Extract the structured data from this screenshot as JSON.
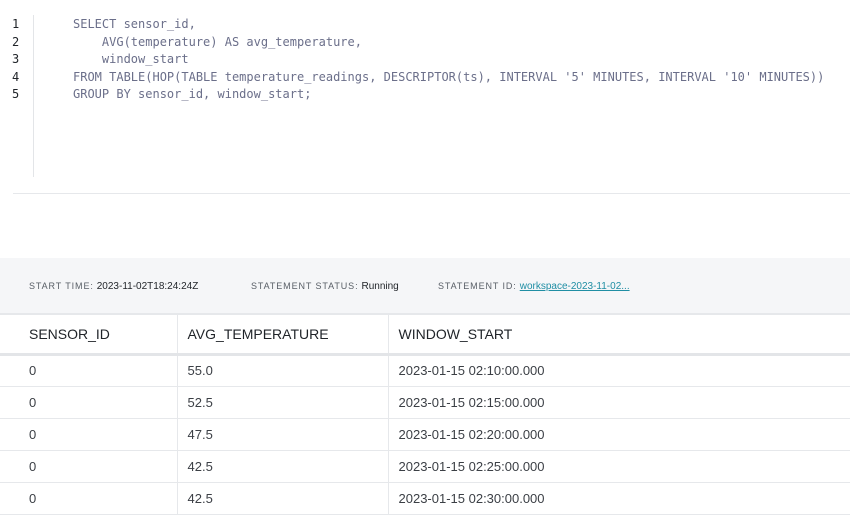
{
  "editor": {
    "line_numbers": [
      "1",
      "2",
      "3",
      "4",
      "5"
    ],
    "lines": [
      "SELECT sensor_id,",
      "    AVG(temperature) AS avg_temperature,",
      "    window_start",
      "FROM TABLE(HOP(TABLE temperature_readings, DESCRIPTOR(ts), INTERVAL '5' MINUTES, INTERVAL '10' MINUTES))",
      "GROUP BY sensor_id, window_start;"
    ]
  },
  "status": {
    "start_time_label": "START TIME:",
    "start_time_value": "2023-11-02T18:24:24Z",
    "statement_status_label": "STATEMENT STATUS:",
    "statement_status_value": "Running",
    "statement_id_label": "STATEMENT ID:",
    "statement_id_value": "workspace-2023-11-02..."
  },
  "table": {
    "columns": [
      "SENSOR_ID",
      "AVG_TEMPERATURE",
      "WINDOW_START"
    ],
    "rows": [
      [
        "0",
        "55.0",
        "2023-01-15 02:10:00.000"
      ],
      [
        "0",
        "52.5",
        "2023-01-15 02:15:00.000"
      ],
      [
        "0",
        "47.5",
        "2023-01-15 02:20:00.000"
      ],
      [
        "0",
        "42.5",
        "2023-01-15 02:25:00.000"
      ],
      [
        "0",
        "42.5",
        "2023-01-15 02:30:00.000"
      ]
    ]
  }
}
